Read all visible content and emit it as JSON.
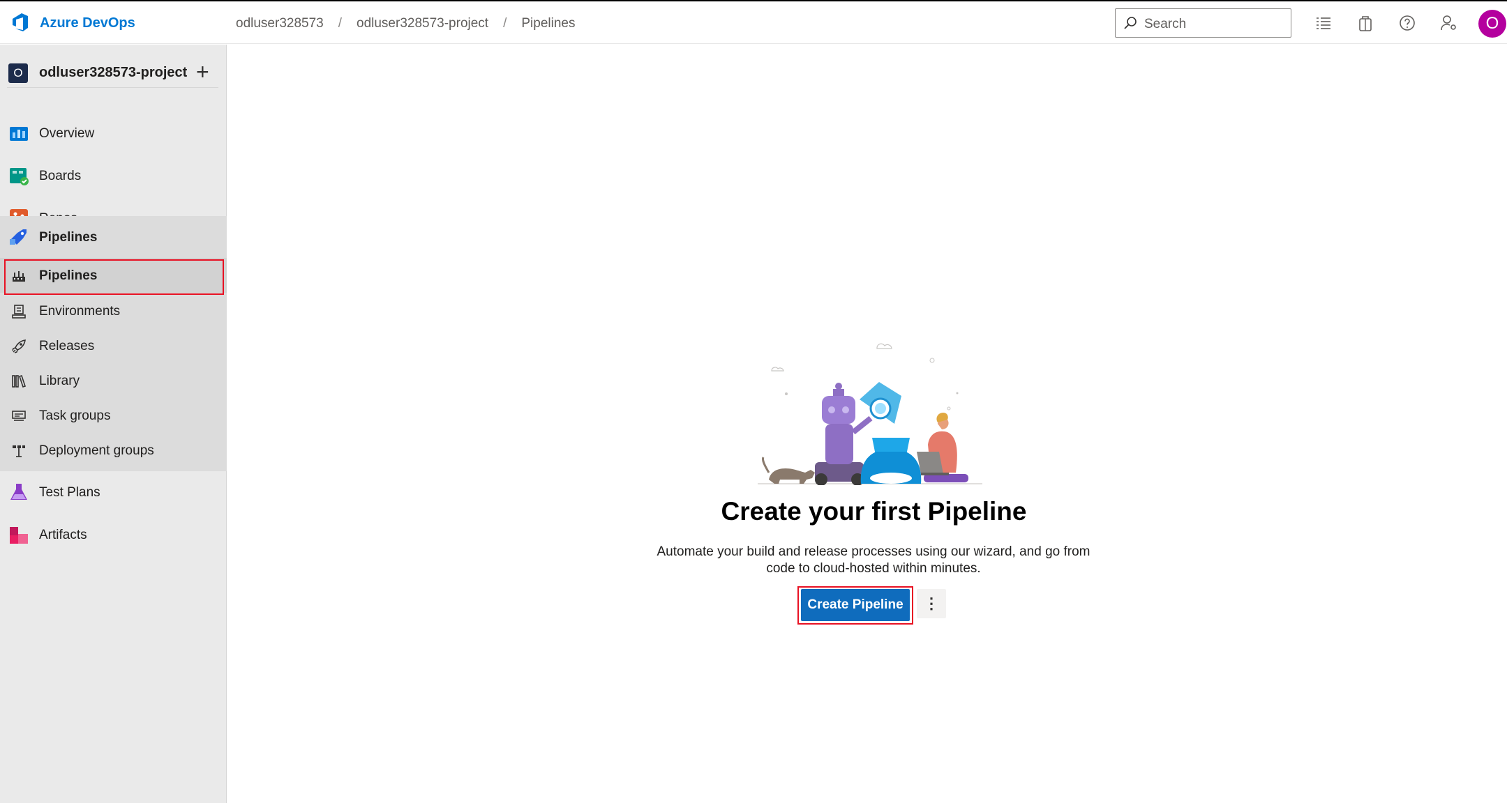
{
  "header": {
    "app_name": "Azure DevOps",
    "breadcrumbs": [
      "odluser328573",
      "odluser328573-project",
      "Pipelines"
    ],
    "breadcrumb_separator": "/",
    "search_placeholder": "Search",
    "avatar_initial": "O"
  },
  "sidebar": {
    "project_initial": "O",
    "project_name": "odluser328573-project",
    "add_symbol": "+",
    "items": [
      {
        "label": "Overview",
        "icon": "overview-icon"
      },
      {
        "label": "Boards",
        "icon": "boards-icon"
      },
      {
        "label": "Repos",
        "icon": "repos-icon"
      },
      {
        "label": "Pipelines",
        "icon": "pipelines-icon"
      },
      {
        "label": "Test Plans",
        "icon": "test-plans-icon"
      },
      {
        "label": "Artifacts",
        "icon": "artifacts-icon"
      }
    ],
    "pipelines_subitems": [
      {
        "label": "Pipelines",
        "icon": "pipelines-sub-icon",
        "selected": true
      },
      {
        "label": "Environments",
        "icon": "environments-icon"
      },
      {
        "label": "Releases",
        "icon": "rocket-icon"
      },
      {
        "label": "Library",
        "icon": "library-icon"
      },
      {
        "label": "Task groups",
        "icon": "task-groups-icon"
      },
      {
        "label": "Deployment groups",
        "icon": "deployment-groups-icon"
      }
    ]
  },
  "main": {
    "title": "Create your first Pipeline",
    "description": "Automate your build and release processes using our wizard, and go from code to cloud-hosted within minutes.",
    "primary_button": "Create Pipeline",
    "more_symbol": "⋮"
  },
  "colors": {
    "accent": "#0f6cbd",
    "brand": "#0078d4",
    "highlight": "#e81123",
    "avatar": "#b4009e"
  }
}
